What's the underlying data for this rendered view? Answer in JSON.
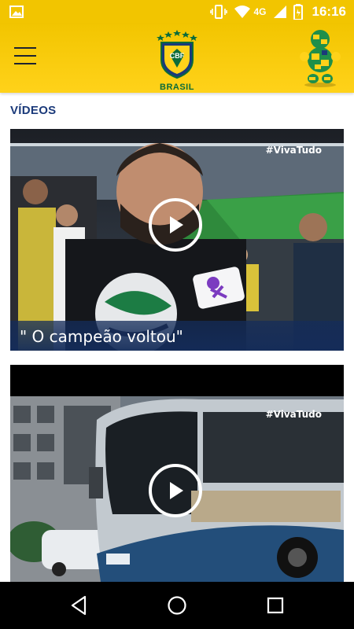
{
  "status_bar": {
    "network": "4G",
    "time": "16:16"
  },
  "header": {
    "logo_text": "CBF",
    "brand": "BRASIL"
  },
  "section": {
    "title": "VÍDEOS"
  },
  "videos": [
    {
      "hashtag": "#VivaTudo",
      "caption": "\" O campeão voltou\""
    },
    {
      "hashtag": "#VivaTudo",
      "caption": ""
    }
  ],
  "colors": {
    "brand_yellow": "#f2c500",
    "brand_green": "#0b6b3a",
    "navy": "#1b3a7a"
  },
  "icons": [
    "image-icon",
    "vibrate-icon",
    "wifi-icon",
    "signal-icon",
    "battery-icon",
    "menu-icon",
    "cbf-logo",
    "mascot-icon",
    "play-icon",
    "back-icon",
    "home-icon",
    "recent-apps-icon"
  ]
}
